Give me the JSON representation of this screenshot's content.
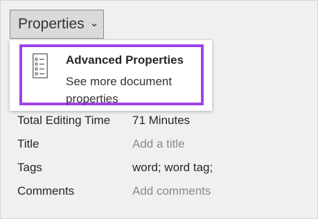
{
  "properties_button": {
    "label": "Properties",
    "icon": "chevron-down-icon"
  },
  "dropdown": {
    "item": {
      "icon": "document-list-icon",
      "title": "Advanced Properties",
      "description": "See more document properties"
    }
  },
  "properties": [
    {
      "label": "Total Editing Time",
      "value": "71 Minutes"
    },
    {
      "label": "Title",
      "value": "Add a title"
    },
    {
      "label": "Tags",
      "value": "word; word tag;"
    },
    {
      "label": "Comments",
      "value": "Add comments"
    }
  ],
  "colors": {
    "highlight_border": "#a141e8",
    "placeholder_text": "#8a8a8a"
  }
}
